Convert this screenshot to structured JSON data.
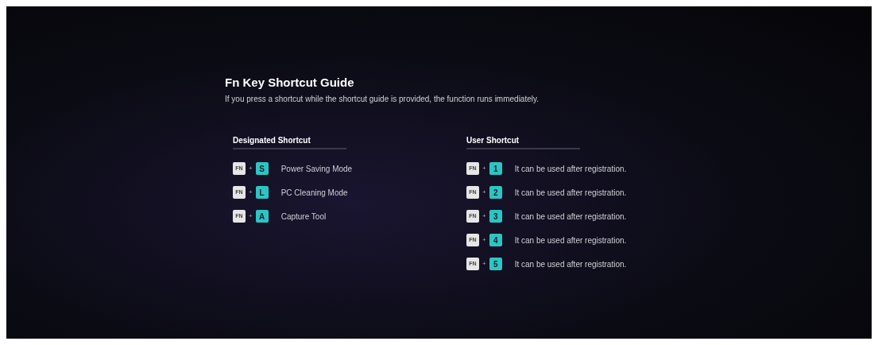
{
  "title": "Fn Key Shortcut Guide",
  "subtitle": "If you press a shortcut while the shortcut guide is provided, the function runs immediately.",
  "sections": [
    {
      "heading": "Designated Shortcut",
      "rows": [
        {
          "modifier": "FN",
          "plus": "+",
          "key": "S",
          "label": "Power Saving Mode"
        },
        {
          "modifier": "FN",
          "plus": "+",
          "key": "L",
          "label": "PC Cleaning Mode"
        },
        {
          "modifier": "FN",
          "plus": "+",
          "key": "A",
          "label": "Capture Tool"
        }
      ]
    },
    {
      "heading": "User Shortcut",
      "rows": [
        {
          "modifier": "FN",
          "plus": "+",
          "key": "1",
          "label": "It can be used after registration."
        },
        {
          "modifier": "FN",
          "plus": "+",
          "key": "2",
          "label": "It can be used after registration."
        },
        {
          "modifier": "FN",
          "plus": "+",
          "key": "3",
          "label": "It can be used after registration."
        },
        {
          "modifier": "FN",
          "plus": "+",
          "key": "4",
          "label": "It can be used after registration."
        },
        {
          "modifier": "FN",
          "plus": "+",
          "key": "5",
          "label": "It can be used after registration."
        }
      ]
    }
  ]
}
